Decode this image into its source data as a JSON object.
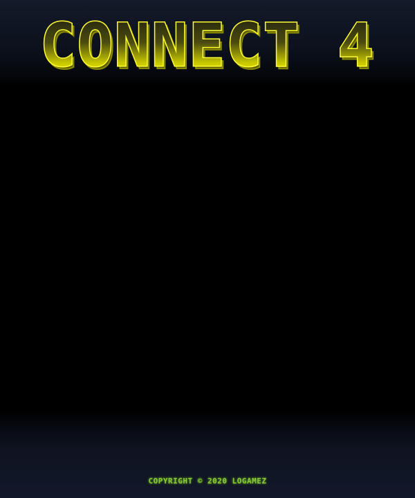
{
  "game": {
    "title": "CONNECT 4",
    "copyright": "COPYRIGHT © 2020 LOGAMEZ"
  },
  "colors": {
    "title_fill_top": "#2a2a12",
    "title_fill_bottom": "#ffff00",
    "title_outline": "#ffff33",
    "title_shadow": "#6b6b00",
    "footer_text": "#8cc63f",
    "background": "#000000",
    "header_band": "#141a29"
  }
}
